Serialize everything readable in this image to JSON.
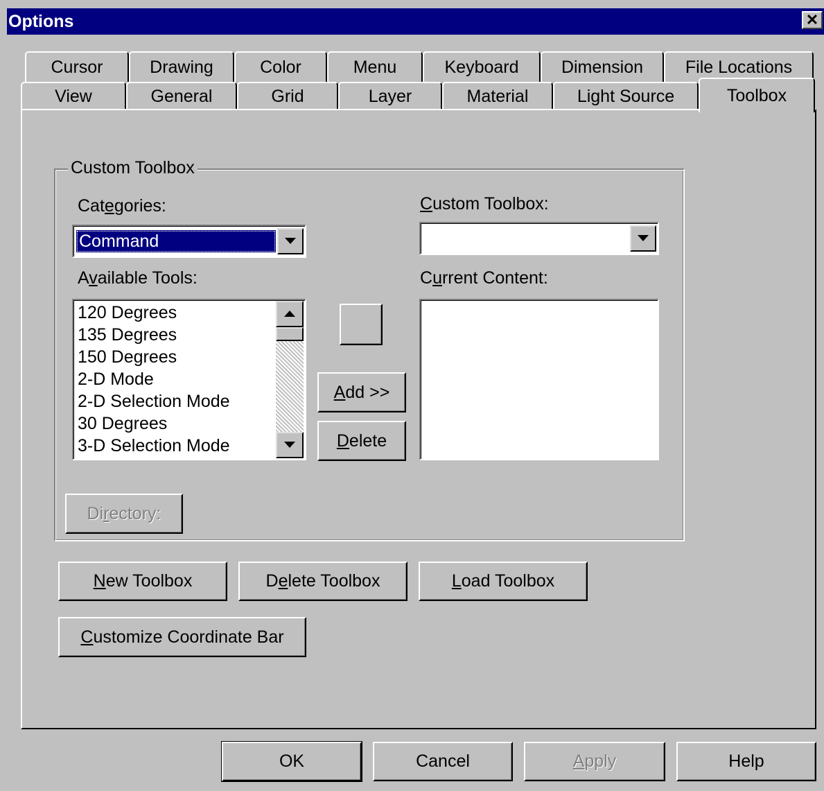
{
  "window": {
    "title": "Options",
    "close_glyph": "✕"
  },
  "tabs": {
    "row1": [
      "Cursor",
      "Drawing",
      "Color",
      "Menu",
      "Keyboard",
      "Dimension",
      "File Locations"
    ],
    "row2": [
      "View",
      "General",
      "Grid",
      "Layer",
      "Material",
      "Light Source",
      "Toolbox"
    ],
    "active": "Toolbox"
  },
  "group": {
    "label": "Custom Toolbox",
    "categories_label": {
      "pre": "Cat",
      "key": "e",
      "post": "gories:"
    },
    "categories_value": "Command",
    "available_label": {
      "pre": "A",
      "key": "v",
      "post": "ailable Tools:"
    },
    "available_tools": [
      "120 Degrees",
      "135 Degrees",
      "150 Degrees",
      "2-D Mode",
      "2-D Selection Mode",
      "30 Degrees",
      "3-D Selection Mode"
    ],
    "custom_label": {
      "pre": "",
      "key": "C",
      "post": "ustom Toolbox:"
    },
    "custom_value": "",
    "current_label": {
      "pre": "C",
      "key": "u",
      "post": "rrent Content:"
    },
    "add_button": {
      "pre": "",
      "key": "A",
      "post": "dd >>"
    },
    "delete_button": {
      "pre": "",
      "key": "D",
      "post": "elete"
    },
    "directory_button": {
      "pre": "Di",
      "key": "r",
      "post": "ectory:"
    }
  },
  "toolbox_buttons": {
    "new": {
      "pre": "",
      "key": "N",
      "post": "ew Toolbox"
    },
    "delete": {
      "pre": "D",
      "key": "e",
      "post": "lete Toolbox"
    },
    "load": {
      "pre": "",
      "key": "L",
      "post": "oad Toolbox"
    },
    "coordinate": {
      "pre": "",
      "key": "C",
      "post": "ustomize Coordinate Bar"
    }
  },
  "dialog_buttons": {
    "ok": "OK",
    "cancel": "Cancel",
    "apply": {
      "pre": "",
      "key": "A",
      "post": "pply"
    },
    "help": "Help"
  },
  "icons": [
    "close-icon",
    "dropdown-arrow-icon",
    "scroll-up-arrow-icon",
    "scroll-down-arrow-icon"
  ]
}
